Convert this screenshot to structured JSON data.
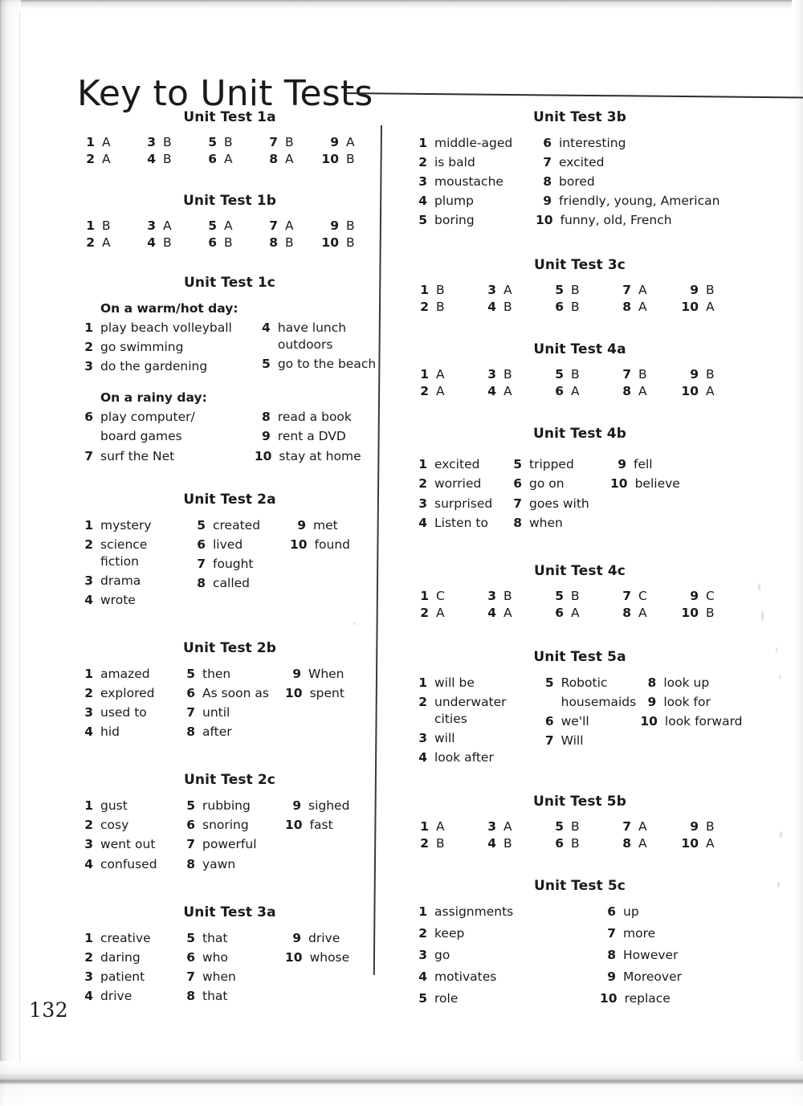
{
  "page": {
    "title": "Key to Unit Tests",
    "number": "132"
  },
  "tests": {
    "t1a": {
      "heading": "Unit Test 1a",
      "answers": [
        {
          "n": "1",
          "v": "A"
        },
        {
          "n": "3",
          "v": "B"
        },
        {
          "n": "5",
          "v": "B"
        },
        {
          "n": "7",
          "v": "B"
        },
        {
          "n": "9",
          "v": "A"
        },
        {
          "n": "2",
          "v": "A"
        },
        {
          "n": "4",
          "v": "B"
        },
        {
          "n": "6",
          "v": "A"
        },
        {
          "n": "8",
          "v": "A"
        },
        {
          "n": "10",
          "v": "B"
        }
      ]
    },
    "t1b": {
      "heading": "Unit Test 1b",
      "answers": [
        {
          "n": "1",
          "v": "B"
        },
        {
          "n": "3",
          "v": "A"
        },
        {
          "n": "5",
          "v": "A"
        },
        {
          "n": "7",
          "v": "A"
        },
        {
          "n": "9",
          "v": "B"
        },
        {
          "n": "2",
          "v": "A"
        },
        {
          "n": "4",
          "v": "B"
        },
        {
          "n": "6",
          "v": "B"
        },
        {
          "n": "8",
          "v": "B"
        },
        {
          "n": "10",
          "v": "B"
        }
      ]
    },
    "t1c": {
      "heading": "Unit Test 1c",
      "sub1": "On a warm/hot day:",
      "sub2": "On a rainy day:",
      "warm_left": [
        {
          "n": "1",
          "t": "play beach volleyball"
        },
        {
          "n": "2",
          "t": "go swimming"
        },
        {
          "n": "3",
          "t": "do the gardening"
        }
      ],
      "warm_right": [
        {
          "n": "4",
          "t": "have lunch outdoors"
        },
        {
          "n": "5",
          "t": "go to the beach"
        }
      ],
      "rainy_left": [
        {
          "n": "6",
          "t": "play computer/"
        },
        {
          "n": "7",
          "t": "surf the Net"
        }
      ],
      "rainy_left_cont": "board games",
      "rainy_right": [
        {
          "n": "8",
          "t": "read a book"
        },
        {
          "n": "9",
          "t": "rent a DVD"
        },
        {
          "n": "10",
          "t": "stay at home"
        }
      ]
    },
    "t2a": {
      "heading": "Unit Test 2a",
      "c1": [
        {
          "n": "1",
          "t": "mystery"
        },
        {
          "n": "2",
          "t": "science fiction"
        },
        {
          "n": "3",
          "t": "drama"
        },
        {
          "n": "4",
          "t": "wrote"
        }
      ],
      "c2": [
        {
          "n": "5",
          "t": "created"
        },
        {
          "n": "6",
          "t": "lived"
        },
        {
          "n": "7",
          "t": "fought"
        },
        {
          "n": "8",
          "t": "called"
        }
      ],
      "c3": [
        {
          "n": "9",
          "t": "met"
        },
        {
          "n": "10",
          "t": "found"
        }
      ]
    },
    "t2b": {
      "heading": "Unit Test 2b",
      "c1": [
        {
          "n": "1",
          "t": "amazed"
        },
        {
          "n": "2",
          "t": "explored"
        },
        {
          "n": "3",
          "t": "used to"
        },
        {
          "n": "4",
          "t": "hid"
        }
      ],
      "c2": [
        {
          "n": "5",
          "t": "then"
        },
        {
          "n": "6",
          "t": "As soon as"
        },
        {
          "n": "7",
          "t": "until"
        },
        {
          "n": "8",
          "t": "after"
        }
      ],
      "c3": [
        {
          "n": "9",
          "t": "When"
        },
        {
          "n": "10",
          "t": "spent"
        }
      ]
    },
    "t2c": {
      "heading": "Unit Test 2c",
      "c1": [
        {
          "n": "1",
          "t": "gust"
        },
        {
          "n": "2",
          "t": "cosy"
        },
        {
          "n": "3",
          "t": "went out"
        },
        {
          "n": "4",
          "t": "confused"
        }
      ],
      "c2": [
        {
          "n": "5",
          "t": "rubbing"
        },
        {
          "n": "6",
          "t": "snoring"
        },
        {
          "n": "7",
          "t": "powerful"
        },
        {
          "n": "8",
          "t": "yawn"
        }
      ],
      "c3": [
        {
          "n": "9",
          "t": "sighed"
        },
        {
          "n": "10",
          "t": "fast"
        }
      ]
    },
    "t3a": {
      "heading": "Unit Test 3a",
      "c1": [
        {
          "n": "1",
          "t": "creative"
        },
        {
          "n": "2",
          "t": "daring"
        },
        {
          "n": "3",
          "t": "patient"
        },
        {
          "n": "4",
          "t": "drive"
        }
      ],
      "c2": [
        {
          "n": "5",
          "t": "that"
        },
        {
          "n": "6",
          "t": "who"
        },
        {
          "n": "7",
          "t": "when"
        },
        {
          "n": "8",
          "t": "that"
        }
      ],
      "c3": [
        {
          "n": "9",
          "t": "drive"
        },
        {
          "n": "10",
          "t": "whose"
        }
      ]
    },
    "t3b": {
      "heading": "Unit Test 3b",
      "c1": [
        {
          "n": "1",
          "t": "middle-aged"
        },
        {
          "n": "2",
          "t": "is bald"
        },
        {
          "n": "3",
          "t": "moustache"
        },
        {
          "n": "4",
          "t": "plump"
        },
        {
          "n": "5",
          "t": "boring"
        }
      ],
      "c2": [
        {
          "n": "6",
          "t": "interesting"
        },
        {
          "n": "7",
          "t": "excited"
        },
        {
          "n": "8",
          "t": "bored"
        },
        {
          "n": "9",
          "t": "friendly, young, American"
        },
        {
          "n": "10",
          "t": "funny, old, French"
        }
      ]
    },
    "t3c": {
      "heading": "Unit Test 3c",
      "answers": [
        {
          "n": "1",
          "v": "B"
        },
        {
          "n": "3",
          "v": "A"
        },
        {
          "n": "5",
          "v": "B"
        },
        {
          "n": "7",
          "v": "A"
        },
        {
          "n": "9",
          "v": "B"
        },
        {
          "n": "2",
          "v": "B"
        },
        {
          "n": "4",
          "v": "B"
        },
        {
          "n": "6",
          "v": "B"
        },
        {
          "n": "8",
          "v": "A"
        },
        {
          "n": "10",
          "v": "A"
        }
      ]
    },
    "t4a": {
      "heading": "Unit Test 4a",
      "answers": [
        {
          "n": "1",
          "v": "A"
        },
        {
          "n": "3",
          "v": "B"
        },
        {
          "n": "5",
          "v": "B"
        },
        {
          "n": "7",
          "v": "B"
        },
        {
          "n": "9",
          "v": "B"
        },
        {
          "n": "2",
          "v": "A"
        },
        {
          "n": "4",
          "v": "A"
        },
        {
          "n": "6",
          "v": "A"
        },
        {
          "n": "8",
          "v": "A"
        },
        {
          "n": "10",
          "v": "A"
        }
      ]
    },
    "t4b": {
      "heading": "Unit Test 4b",
      "c1": [
        {
          "n": "1",
          "t": "excited"
        },
        {
          "n": "2",
          "t": "worried"
        },
        {
          "n": "3",
          "t": "surprised"
        },
        {
          "n": "4",
          "t": "Listen to"
        }
      ],
      "c2": [
        {
          "n": "5",
          "t": "tripped"
        },
        {
          "n": "6",
          "t": "go on"
        },
        {
          "n": "7",
          "t": "goes with"
        },
        {
          "n": "8",
          "t": "when"
        }
      ],
      "c3": [
        {
          "n": "9",
          "t": "fell"
        },
        {
          "n": "10",
          "t": "believe"
        }
      ]
    },
    "t4c": {
      "heading": "Unit Test 4c",
      "answers": [
        {
          "n": "1",
          "v": "C"
        },
        {
          "n": "3",
          "v": "B"
        },
        {
          "n": "5",
          "v": "B"
        },
        {
          "n": "7",
          "v": "C"
        },
        {
          "n": "9",
          "v": "C"
        },
        {
          "n": "2",
          "v": "A"
        },
        {
          "n": "4",
          "v": "A"
        },
        {
          "n": "6",
          "v": "A"
        },
        {
          "n": "8",
          "v": "A"
        },
        {
          "n": "10",
          "v": "B"
        }
      ]
    },
    "t5a": {
      "heading": "Unit Test 5a",
      "c1": [
        {
          "n": "1",
          "t": "will be"
        },
        {
          "n": "2",
          "t": "underwater cities"
        },
        {
          "n": "3",
          "t": "will"
        },
        {
          "n": "4",
          "t": "look after"
        }
      ],
      "c2": [
        {
          "n": "5",
          "t": "Robotic"
        },
        {
          "n": "6",
          "t": "we'll"
        },
        {
          "n": "7",
          "t": "Will"
        }
      ],
      "c2_cont": "housemaids",
      "c3": [
        {
          "n": "8",
          "t": "look up"
        },
        {
          "n": "9",
          "t": "look for"
        },
        {
          "n": "10",
          "t": "look forward"
        }
      ]
    },
    "t5b": {
      "heading": "Unit Test 5b",
      "answers": [
        {
          "n": "1",
          "v": "A"
        },
        {
          "n": "3",
          "v": "A"
        },
        {
          "n": "5",
          "v": "B"
        },
        {
          "n": "7",
          "v": "A"
        },
        {
          "n": "9",
          "v": "B"
        },
        {
          "n": "2",
          "v": "B"
        },
        {
          "n": "4",
          "v": "B"
        },
        {
          "n": "6",
          "v": "B"
        },
        {
          "n": "8",
          "v": "A"
        },
        {
          "n": "10",
          "v": "A"
        }
      ]
    },
    "t5c": {
      "heading": "Unit Test 5c",
      "c1": [
        {
          "n": "1",
          "t": "assignments"
        },
        {
          "n": "2",
          "t": "keep"
        },
        {
          "n": "3",
          "t": "go"
        },
        {
          "n": "4",
          "t": "motivates"
        },
        {
          "n": "5",
          "t": "role"
        }
      ],
      "c2": [
        {
          "n": "6",
          "t": "up"
        },
        {
          "n": "7",
          "t": "more"
        },
        {
          "n": "8",
          "t": "However"
        },
        {
          "n": "9",
          "t": "Moreover"
        },
        {
          "n": "10",
          "t": "replace"
        }
      ]
    }
  }
}
